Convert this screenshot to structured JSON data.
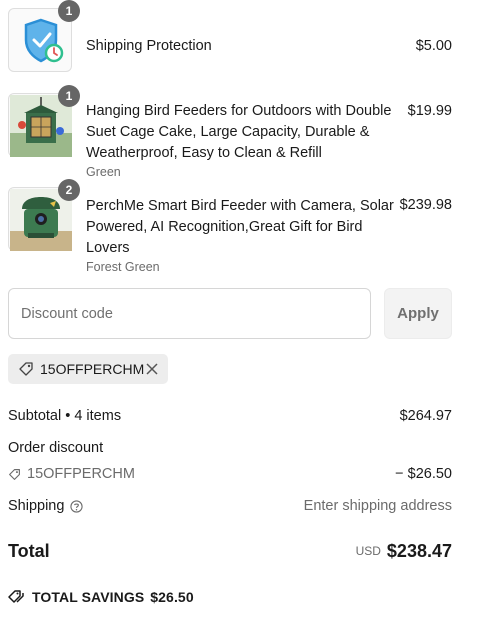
{
  "line_items": [
    {
      "title": "Shipping Protection",
      "variant": "",
      "price": "$5.00",
      "quantity": "1",
      "image_icon": "shield-clock-icon"
    },
    {
      "title": "Hanging Bird Feeders for Outdoors with Double Suet Cage Cake, Large Capacity, Durable & Weatherproof, Easy to Clean & Refill",
      "variant": "Green",
      "price": "$19.99",
      "quantity": "1",
      "image_icon": "bird-feeder-image"
    },
    {
      "title": "PerchMe Smart Bird Feeder with Camera, Solar Powered, AI Recognition,Great Gift for Bird Lovers",
      "variant": "Forest Green",
      "price": "$239.98",
      "quantity": "2",
      "image_icon": "smart-feeder-image"
    }
  ],
  "discount": {
    "placeholder": "Discount code",
    "value": "",
    "apply_label": "Apply",
    "applied_code": "15OFFPERCHM"
  },
  "summary": {
    "subtotal_label": "Subtotal • 4 items",
    "subtotal_value": "$264.97",
    "order_discount_label": "Order discount",
    "order_discount_code": "15OFFPERCHM",
    "order_discount_value": "− $26.50",
    "shipping_label": "Shipping",
    "shipping_value": "Enter shipping address",
    "total_label": "Total",
    "total_currency": "USD",
    "total_value": "$238.47",
    "savings_label": "TOTAL SAVINGS",
    "savings_value": "$26.50"
  },
  "colors": {
    "accent_shield": "#2b8fd6",
    "accent_clock": "#2fbf8f",
    "badge": "#666666",
    "muted_text": "#6b6b6b"
  }
}
